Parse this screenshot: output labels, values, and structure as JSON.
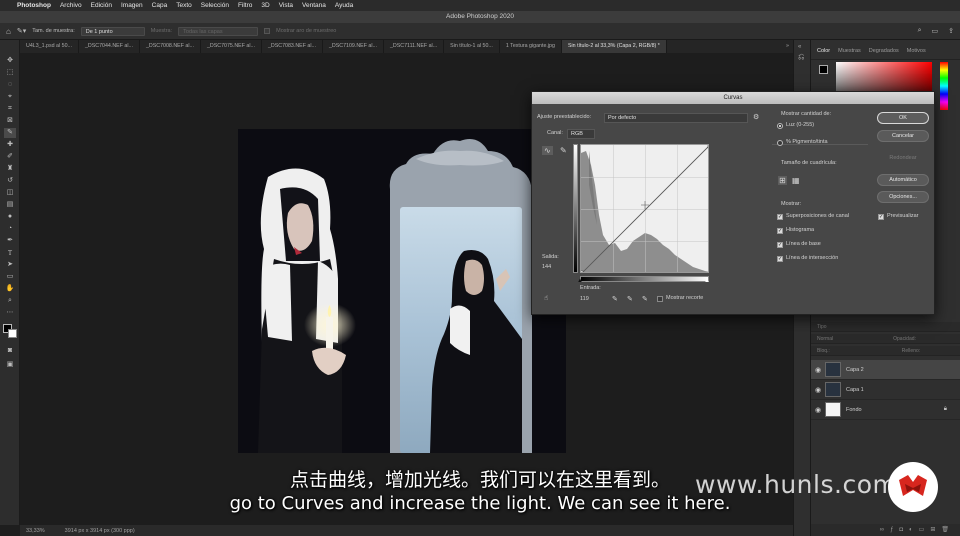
{
  "menubar": {
    "app_name": "Photoshop",
    "items": [
      "Archivo",
      "Edición",
      "Imagen",
      "Capa",
      "Texto",
      "Selección",
      "Filtro",
      "3D",
      "Vista",
      "Ventana",
      "Ayuda"
    ]
  },
  "window": {
    "title": "Adobe Photoshop 2020"
  },
  "options": {
    "sample_label": "Tam. de muestra:",
    "sample_value": "De 1 punto",
    "sample2_label": "Muestra:",
    "sample2_value": "Todas las capas",
    "ring_label": "Mostrar aro de muestreo"
  },
  "tabs": [
    "U4L3_1.psd al 50...",
    "_DSC7044.NEF al...",
    "_DSC7008.NEF al...",
    "_DSC7075.NEF al...",
    "_DSC7083.NEF al...",
    "_DSC7109.NEF al...",
    "_DSC7111.NEF al...",
    "Sin título-1 al 50...",
    "1 Textura gigante.jpg",
    "Sin título-2 al 33,3% (Capa 2, RGB/8) *"
  ],
  "tabs_more": "»",
  "status": {
    "zoom": "33,33%",
    "doc_info": "3914 px x 3914 px (300 ppp)"
  },
  "panels": {
    "tabs": [
      "Color",
      "Muestras",
      "Degradados",
      "Motivos"
    ],
    "active_tab": "Color",
    "layer_bars": [
      "Tipo",
      "Normal",
      "Opacidad:",
      "Bloq.:",
      "Relleno:"
    ],
    "layers": [
      {
        "name": "Capa 2",
        "selected": true
      },
      {
        "name": "Capa 1",
        "selected": false
      },
      {
        "name": "Fondo",
        "selected": false,
        "locked": true
      }
    ]
  },
  "curves": {
    "title": "Curvas",
    "preset_label": "Ajuste preestablecido:",
    "preset_value": "Por defecto",
    "channel_label": "Canal:",
    "channel_value": "RGB",
    "output_label": "Salida:",
    "output_value": "144",
    "input_label": "Entrada:",
    "input_value": "119",
    "show_clipping": "Mostrar recorte",
    "show_amount_label": "Mostrar cantidad de:",
    "light_option": "Luz (0-255)",
    "pigment_option": "% Pigmento/tinta",
    "grid_size_label": "Tamaño de cuadrícula:",
    "show_label": "Mostrar:",
    "show_options": [
      "Superposiciones de canal",
      "Histograma",
      "Línea de base",
      "Línea de intersección"
    ],
    "buttons": {
      "ok": "OK",
      "cancel": "Cancelar",
      "smooth": "Redondear",
      "auto": "Automático",
      "options": "Opciones..."
    },
    "preview_label": "Previsualizar"
  },
  "subtitles": {
    "chinese": "点击曲线，增加光线。我们可以在这里看到。",
    "english": "go to Curves and increase the light. We can see it here."
  },
  "watermark": "www.hunls.com"
}
